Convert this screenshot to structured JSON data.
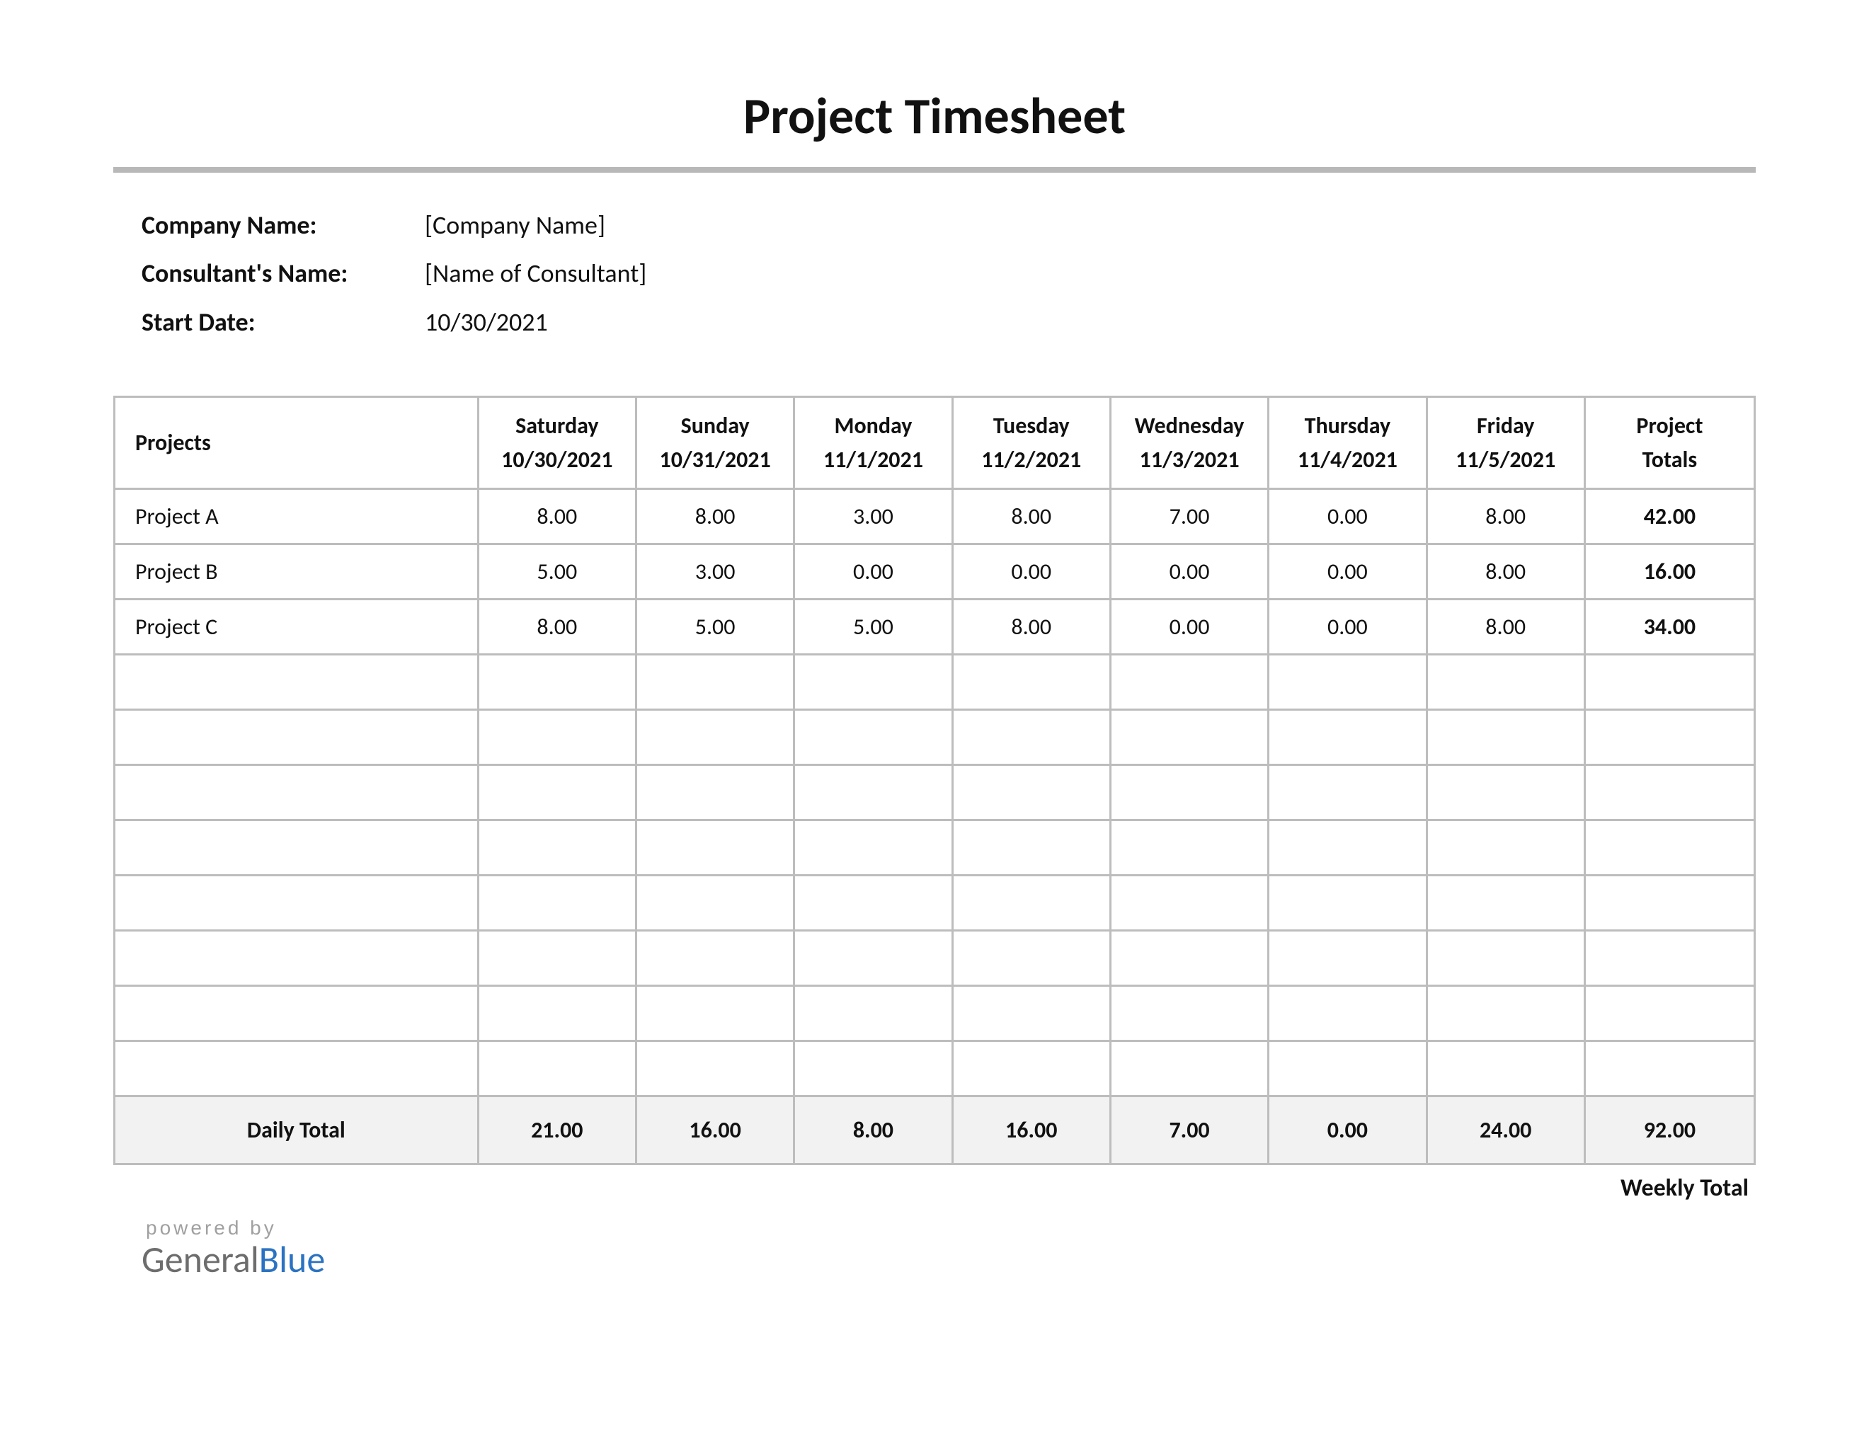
{
  "title": "Project Timesheet",
  "meta": {
    "company_label": "Company Name:",
    "company_value": "[Company Name]",
    "consultant_label": "Consultant's Name:",
    "consultant_value": "[Name of Consultant]",
    "start_date_label": "Start Date:",
    "start_date_value": "10/30/2021"
  },
  "table": {
    "projects_header": "Projects",
    "totals_header": "Project Totals",
    "days": [
      {
        "name": "Saturday",
        "date": "10/30/2021"
      },
      {
        "name": "Sunday",
        "date": "10/31/2021"
      },
      {
        "name": "Monday",
        "date": "11/1/2021"
      },
      {
        "name": "Tuesday",
        "date": "11/2/2021"
      },
      {
        "name": "Wednesday",
        "date": "11/3/2021"
      },
      {
        "name": "Thursday",
        "date": "11/4/2021"
      },
      {
        "name": "Friday",
        "date": "11/5/2021"
      }
    ],
    "rows": [
      {
        "name": "Project A",
        "hours": [
          "8.00",
          "8.00",
          "3.00",
          "8.00",
          "7.00",
          "0.00",
          "8.00"
        ],
        "total": "42.00"
      },
      {
        "name": "Project B",
        "hours": [
          "5.00",
          "3.00",
          "0.00",
          "0.00",
          "0.00",
          "0.00",
          "8.00"
        ],
        "total": "16.00"
      },
      {
        "name": "Project C",
        "hours": [
          "8.00",
          "5.00",
          "5.00",
          "8.00",
          "0.00",
          "0.00",
          "8.00"
        ],
        "total": "34.00"
      },
      {
        "name": "",
        "hours": [
          "",
          "",
          "",
          "",
          "",
          "",
          ""
        ],
        "total": ""
      },
      {
        "name": "",
        "hours": [
          "",
          "",
          "",
          "",
          "",
          "",
          ""
        ],
        "total": ""
      },
      {
        "name": "",
        "hours": [
          "",
          "",
          "",
          "",
          "",
          "",
          ""
        ],
        "total": ""
      },
      {
        "name": "",
        "hours": [
          "",
          "",
          "",
          "",
          "",
          "",
          ""
        ],
        "total": ""
      },
      {
        "name": "",
        "hours": [
          "",
          "",
          "",
          "",
          "",
          "",
          ""
        ],
        "total": ""
      },
      {
        "name": "",
        "hours": [
          "",
          "",
          "",
          "",
          "",
          "",
          ""
        ],
        "total": ""
      },
      {
        "name": "",
        "hours": [
          "",
          "",
          "",
          "",
          "",
          "",
          ""
        ],
        "total": ""
      },
      {
        "name": "",
        "hours": [
          "",
          "",
          "",
          "",
          "",
          "",
          ""
        ],
        "total": ""
      }
    ],
    "daily_total_label": "Daily Total",
    "daily_totals": [
      "21.00",
      "16.00",
      "8.00",
      "16.00",
      "7.00",
      "0.00",
      "24.00"
    ],
    "weekly_total": "92.00",
    "weekly_total_label": "Weekly Total"
  },
  "branding": {
    "powered_by": "powered by",
    "general": "General",
    "blue": "Blue"
  }
}
